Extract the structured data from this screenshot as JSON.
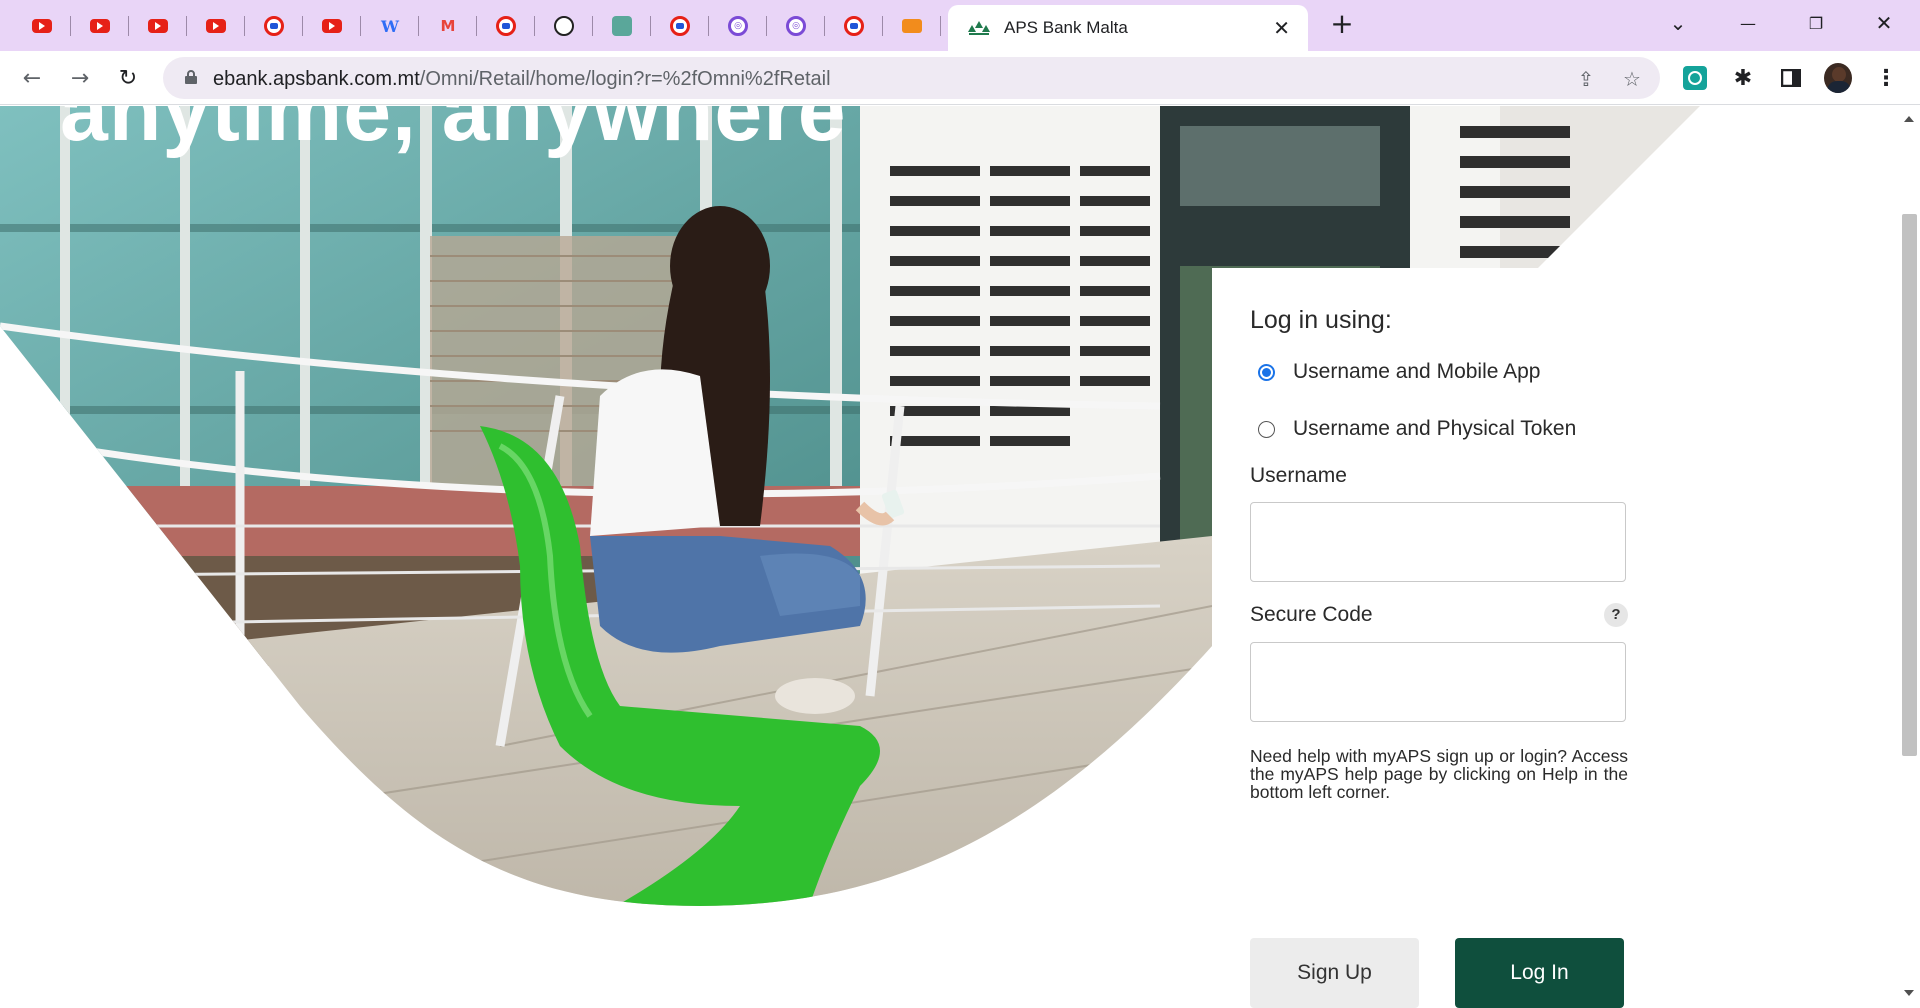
{
  "browser": {
    "pinned_tabs": [
      {
        "icon": "youtube-icon"
      },
      {
        "icon": "youtube-icon"
      },
      {
        "icon": "youtube-icon"
      },
      {
        "icon": "youtube-icon"
      },
      {
        "icon": "youtube-ring-icon"
      },
      {
        "icon": "youtube-icon"
      },
      {
        "icon": "w-logo-icon"
      },
      {
        "icon": "m-logo-icon"
      },
      {
        "icon": "youtube-ring-icon"
      },
      {
        "icon": "openai-icon"
      },
      {
        "icon": "chatgpt-icon"
      },
      {
        "icon": "youtube-ring-icon"
      },
      {
        "icon": "purple-app-icon"
      },
      {
        "icon": "purple-app-icon"
      },
      {
        "icon": "youtube-ring-icon"
      },
      {
        "icon": "game-icon"
      }
    ],
    "active_tab": {
      "title": "APS Bank Malta",
      "close": "✕",
      "icon": "aps-bank-logo-icon"
    },
    "new_tab": "+",
    "window_controls": {
      "dropdown": "⌄",
      "minimize": "—",
      "restore": "❐",
      "close": "✕"
    },
    "nav": {
      "back": "←",
      "forward": "→",
      "reload": "↻"
    },
    "url": {
      "host": "ebank.apsbank.com.mt",
      "path": "/Omni/Retail/home/login?r=%2fOmni%2fRetail"
    },
    "toolbar_icons": {
      "share": "⇪",
      "star": "☆",
      "extensions": "✱",
      "menu": "⋮"
    }
  },
  "hero": {
    "headline": "anytime, anywhere",
    "colors": {
      "chair_green": "#2fbf2f",
      "glass_teal": "#5a9f9a",
      "sky": "#cfe8ee"
    }
  },
  "login": {
    "heading": "Log in using:",
    "options": [
      {
        "label": "Username and Mobile App",
        "checked": true
      },
      {
        "label": "Username and Physical Token",
        "checked": false
      }
    ],
    "username_label": "Username",
    "username_value": "",
    "secure_code_label": "Secure Code",
    "secure_code_help": "?",
    "secure_code_value": "",
    "help_text": "Need help with myAPS sign up or login? Access the myAPS help page by clicking on Help in the bottom left corner.",
    "signup_label": "Sign Up",
    "login_label": "Log In",
    "accent": "#0f4f3d"
  }
}
